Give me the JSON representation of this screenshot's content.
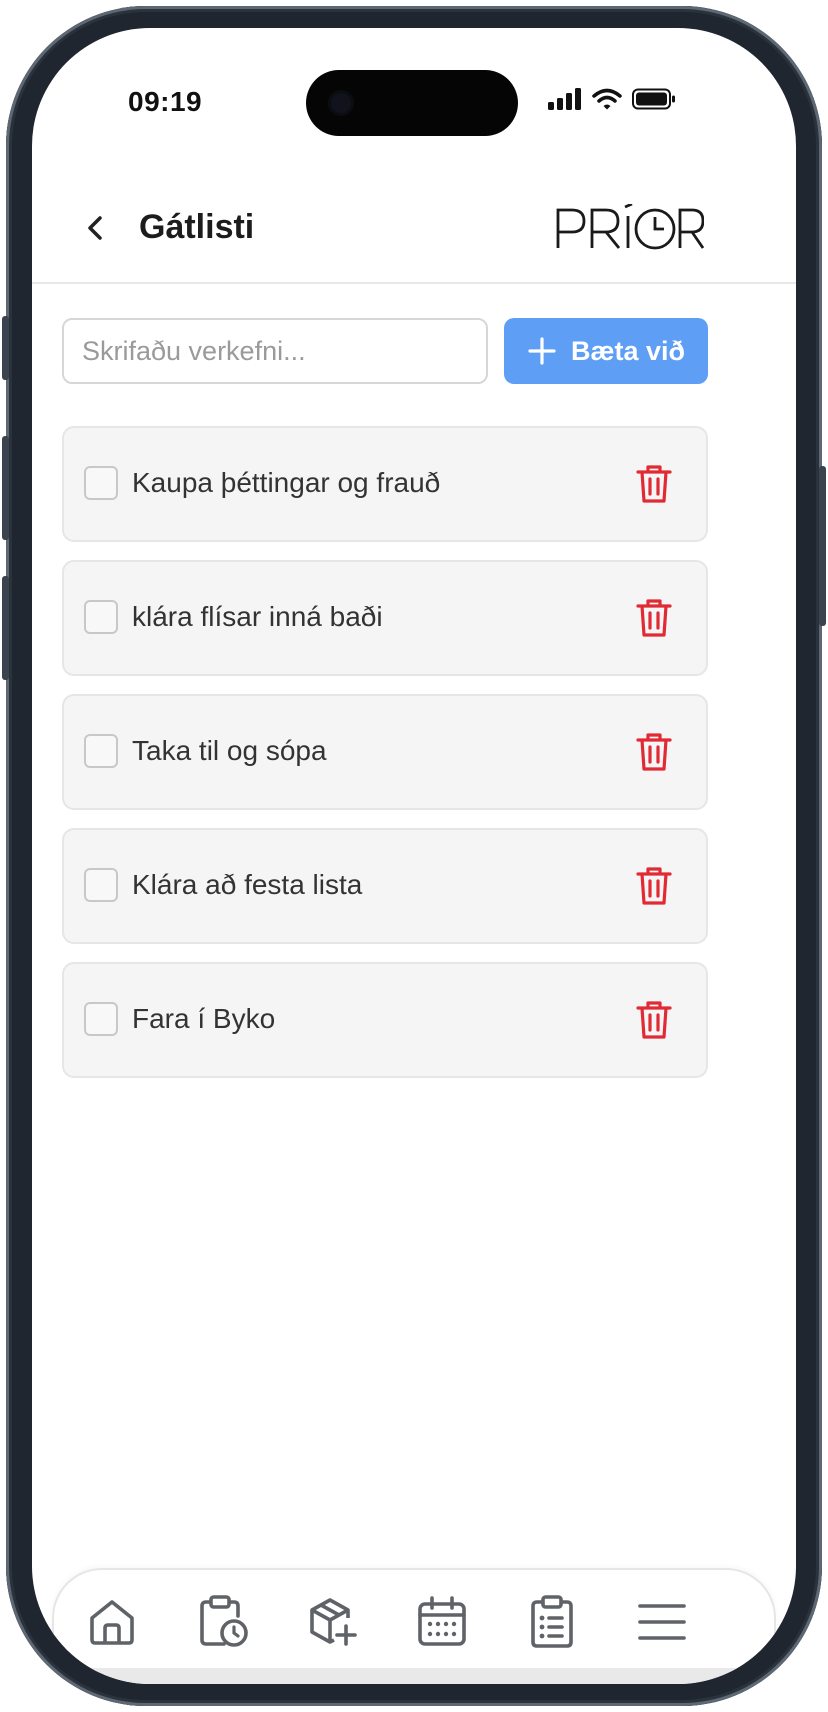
{
  "status_bar": {
    "time": "09:19",
    "icons": [
      "signal-icon",
      "wifi-icon",
      "battery-icon"
    ]
  },
  "header": {
    "title": "Gátlisti",
    "logo_text": "PRÍOR",
    "back_icon": "chevron-left-icon"
  },
  "add_task": {
    "placeholder": "Skrifaðu verkefni...",
    "value": "",
    "button_label": "Bæta við",
    "button_icon": "plus-icon"
  },
  "tasks": [
    {
      "label": "Kaupa þéttingar og frauð",
      "checked": false
    },
    {
      "label": "klára flísar inná baði",
      "checked": false
    },
    {
      "label": "Taka til og sópa",
      "checked": false
    },
    {
      "label": "Klára að festa lista",
      "checked": false
    },
    {
      "label": "Fara í Byko",
      "checked": false
    }
  ],
  "bottom_nav": {
    "items": [
      "home-icon",
      "clipboard-clock-icon",
      "package-add-icon",
      "calendar-icon",
      "checklist-icon",
      "menu-icon"
    ]
  },
  "colors": {
    "accent": "#5e9ff5",
    "delete": "#e02b35",
    "card_bg": "#f5f5f5",
    "nav_icon": "#5f6368"
  }
}
